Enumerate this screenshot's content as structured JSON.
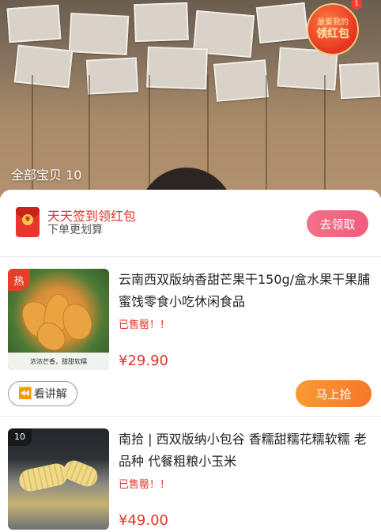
{
  "live": {
    "all_items_label": "全部宝贝 10",
    "redpacket_badge": {
      "line1": "最爱我的",
      "line2": "领红包",
      "dot": "1"
    }
  },
  "signin": {
    "title": "天天签到领红包",
    "subtitle": "下单更划算",
    "button": "去领取",
    "coin_symbol": "¥"
  },
  "products": [
    {
      "tag": "热",
      "thumb_caption": "浓浓芒香，甜甜软糯",
      "title": "云南西双版纳香甜芒果干150g/盒水果干果脯蜜饯零食小吃休闲食品",
      "sold_status": "已售罄！！",
      "price": "¥29.90",
      "explain_label": "看讲解",
      "buy_label": "马上抢"
    },
    {
      "tag": "10",
      "title": "南拾 | 西双版纳小包谷 香糯甜糯花糯软糯 老品种 代餐粗粮小玉米",
      "sold_status": "已售罄！！",
      "price": "¥49.00"
    }
  ],
  "colors": {
    "accent_red": "#e5332a",
    "claim_pink": "#ef5d7a",
    "buy_orange": "#f8772b"
  }
}
